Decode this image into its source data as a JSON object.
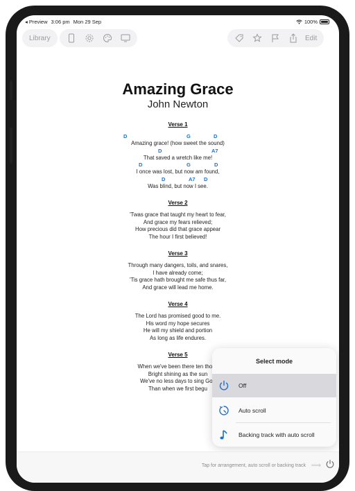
{
  "status_bar": {
    "back_label": "◂ Preview",
    "time": "3:06 pm",
    "date": "Mon 29 Sep",
    "battery": "100%"
  },
  "toolbar": {
    "library_label": "Library",
    "edit_label": "Edit"
  },
  "song": {
    "title": "Amazing Grace",
    "author": "John Newton",
    "verses": [
      {
        "heading": "Verse 1",
        "lines": [
          {
            "chords": [
              "D",
              "G",
              "D"
            ],
            "text": "Amazing grace! (how sweet the sound)"
          },
          {
            "chords": [
              "D",
              "A7"
            ],
            "text": "That saved a wretch like me!"
          },
          {
            "chords": [
              "D",
              "G",
              "D"
            ],
            "text": "I once was lost, but now am found,"
          },
          {
            "chords": [
              "D",
              "A7",
              "D"
            ],
            "text": "Was blind, but now I see."
          }
        ]
      },
      {
        "heading": "Verse 2",
        "lines": [
          "'Twas grace that taught my heart to fear,",
          "And grace my fears relieved;",
          "How precious did that grace appear",
          "The hour I first believed!"
        ]
      },
      {
        "heading": "Verse 3",
        "lines": [
          "Through many dangers, toils, and snares,",
          "I have already come;",
          "'Tis grace hath brought me safe thus far,",
          "And grace will lead me home."
        ]
      },
      {
        "heading": "Verse 4",
        "lines": [
          "The Lord has promised good to me.",
          "His word my hope secures",
          "He will my shield and portion",
          "As long as life endures."
        ]
      },
      {
        "heading": "Verse 5",
        "lines": [
          "When we've been there ten thous",
          "Bright shining as the sun",
          "We've no less days to sing God",
          "Than when we first begu"
        ]
      }
    ]
  },
  "mode_popup": {
    "title": "Select mode",
    "options": [
      {
        "label": "Off",
        "icon": "power-icon",
        "selected": true
      },
      {
        "label": "Auto scroll",
        "icon": "auto-scroll-icon",
        "selected": false
      },
      {
        "label": "Backing track with auto scroll",
        "icon": "music-note-icon",
        "selected": false
      }
    ]
  },
  "bottom_bar": {
    "hint": "Tap for arrangement, auto scroll or backing track"
  },
  "colors": {
    "accent": "#1f6fc9",
    "toolbar_icon": "#9a9aa0",
    "selected_row": "#d9d9dd"
  }
}
